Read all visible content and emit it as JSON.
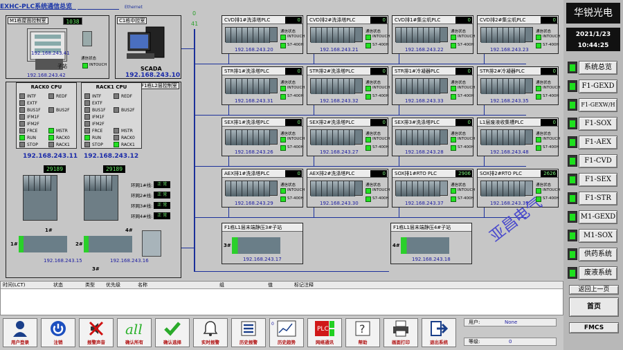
{
  "app": {
    "title": "EXHC-PLC系统通信总览",
    "ethernet": "Ethernet",
    "brand": "华锐光电",
    "date": "2021/1/23",
    "time": "10:44:25",
    "watermark": "亚昌电气",
    "counter_a": "0",
    "counter_b": "41"
  },
  "rooms": {
    "m1": {
      "label": "M1栋屋面控制室",
      "value": "1038",
      "ip1": "192.168.243.41",
      "ip2": "192.168.243.42",
      "sub": "子站",
      "comm": "通信状态",
      "intouch": "INTOUCH"
    },
    "c1": {
      "label": "C1栋中控室",
      "scada": "SCADA",
      "ip": "192.168.243.10"
    },
    "f1": {
      "label": "F1栋L2层控制室"
    }
  },
  "racks": [
    {
      "title": "RACK0 CPU",
      "left": [
        "INTF",
        "EXTF",
        "BUS1F",
        "IFM1F",
        "IFM2F",
        "FRCE",
        "RUN",
        "STOP"
      ],
      "right": [
        "REDF",
        "BUS2F",
        "MSTR",
        "RACK0",
        "RACK1"
      ],
      "ip": "192.168.243.11"
    },
    {
      "title": "RACK1 CPU",
      "left": [
        "INTF",
        "EXTF",
        "BUS1F",
        "IFM1F",
        "IFM2F",
        "FRCE",
        "RUN",
        "STOP"
      ],
      "right": [
        "REDF",
        "BUS2F",
        "MSTR",
        "RACK0",
        "RACK1"
      ],
      "ip": "192.168.243.12"
    }
  ],
  "cpu_counts": [
    "29189",
    "29189"
  ],
  "rings": [
    {
      "label": "环网1#线:",
      "state": "正 常"
    },
    {
      "label": "环网2#线:",
      "state": "正 常"
    },
    {
      "label": "环网3#线:",
      "state": "正 常"
    },
    {
      "label": "环网4#线:",
      "state": "正 常"
    }
  ],
  "f1_stations": {
    "s1": "1#",
    "s2": "2#",
    "s3": "3#",
    "s4": "4#",
    "ip15": "192.168.243.15",
    "ip16": "192.168.243.16"
  },
  "plcs": [
    {
      "title": "CVD排1#洗涤塔PLC",
      "value": "0",
      "ip": "192.168.243.20"
    },
    {
      "title": "CVD排2#洗涤塔PLC",
      "value": "0",
      "ip": "192.168.243.21"
    },
    {
      "title": "CVD排1#集尘机PLC",
      "value": "0",
      "ip": "192.168.243.22"
    },
    {
      "title": "CVD排2#集尘机PLC",
      "value": "0",
      "ip": "192.168.243.23"
    },
    {
      "title": "STR排1#洗涤塔PLC",
      "value": "0",
      "ip": "192.168.243.31"
    },
    {
      "title": "STR排2#洗涤塔PLC",
      "value": "0",
      "ip": "192.168.243.32"
    },
    {
      "title": "STR排1#冷凝器PLC",
      "value": "0",
      "ip": "192.168.243.33"
    },
    {
      "title": "STR排2#冷凝器PLC",
      "value": "0",
      "ip": "192.168.243.35"
    },
    {
      "title": "SEX排1#洗涤塔PLC",
      "value": "0",
      "ip": "192.168.243.26"
    },
    {
      "title": "SEX排2#洗涤塔PLC",
      "value": "0",
      "ip": "192.168.243.27"
    },
    {
      "title": "SEX排3#洗涤塔PLC",
      "value": "0",
      "ip": "192.168.243.28"
    },
    {
      "title": "L1层废液收集槽PLC",
      "value": "0",
      "ip": "192.168.243.48"
    },
    {
      "title": "AEX排1#洗涤塔PLC",
      "value": "0",
      "ip": "192.168.243.29"
    },
    {
      "title": "AEX排2#洗涤塔PLC",
      "value": "0",
      "ip": "192.168.243.30"
    },
    {
      "title": "SOX排1#RTO PLC",
      "value": "2906",
      "ip": "192.168.243.37"
    },
    {
      "title": "SOX排2#RTO PLC",
      "value": "2626",
      "ip": "192.168.243.39"
    }
  ],
  "plc_status": {
    "comm": "通信状态",
    "intouch": "INTOUCH",
    "s7": "S7-400H"
  },
  "substations": [
    {
      "title": "F1栋L1层末端静压3#子站",
      "tag": "3#",
      "ip": "192.168.243.17"
    },
    {
      "title": "F1栋L1层末端静压4#子站",
      "tag": "4#",
      "ip": "192.168.243.18"
    }
  ],
  "nav": [
    "系统总览",
    "F1-GEXD",
    "F1-GEXW/H",
    "F1-SOX",
    "F1-AEX",
    "F1-CVD",
    "F1-SEX",
    "F1-STR",
    "M1-GEXD",
    "M1-SOX",
    "供药系统",
    "废液系统"
  ],
  "nav_bottom": {
    "back": "返回上一页",
    "home": "首页",
    "fmcs": "FMCS"
  },
  "alarm_cols": [
    "时间(LCT)",
    "状态",
    "类型",
    "优先级",
    "名称",
    "组",
    "值",
    "标记注释"
  ],
  "toolbar": [
    {
      "label": "用户登录",
      "icon": "user-icon"
    },
    {
      "label": "注销",
      "icon": "power-icon"
    },
    {
      "label": "报警声音",
      "icon": "mute-icon"
    },
    {
      "label": "确认所有",
      "icon": "all-icon"
    },
    {
      "label": "确认选择",
      "icon": "check-icon"
    },
    {
      "label": "实时报警",
      "icon": "bell-icon"
    },
    {
      "label": "历史报警",
      "icon": "list-icon"
    },
    {
      "label": "历史趋势",
      "icon": "trend-icon"
    },
    {
      "label": "网络通讯",
      "icon": "plc-icon"
    },
    {
      "label": "帮助",
      "icon": "help-icon"
    },
    {
      "label": "画面打印",
      "icon": "printer-icon"
    },
    {
      "label": "退出系统",
      "icon": "exit-icon"
    }
  ],
  "trend_zero": "0",
  "user": {
    "label": "用户:",
    "value": "None",
    "level_label": "等级:",
    "level_value": "0"
  },
  "colors": {
    "led_on": "#22e022",
    "text_red": "#b01010",
    "ip_blue": "#1a2aa8"
  }
}
